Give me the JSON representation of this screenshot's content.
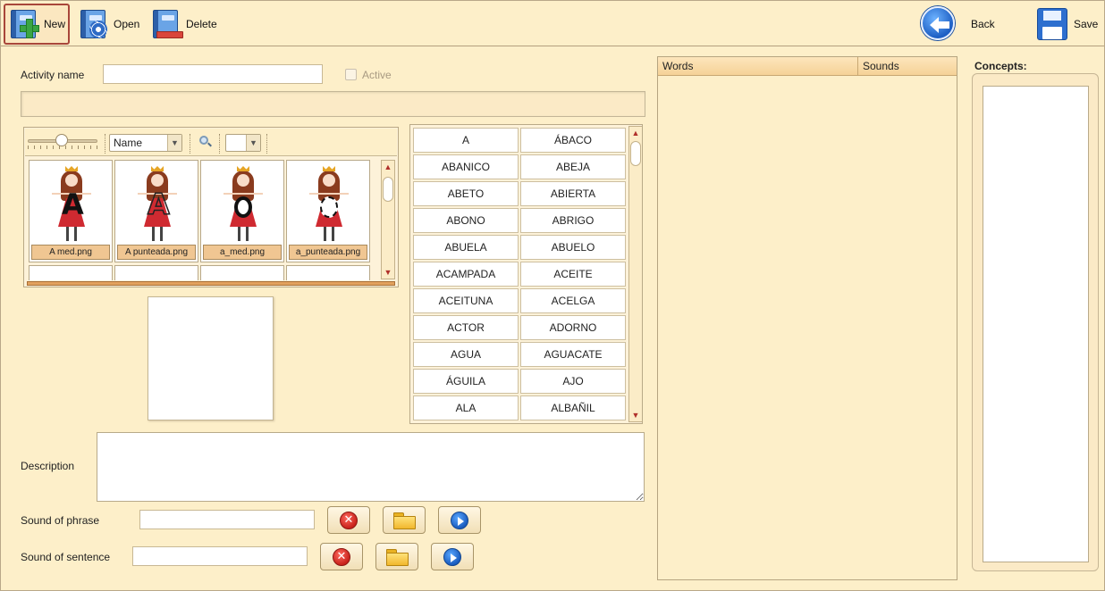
{
  "toolbar": {
    "new_label": "New",
    "open_label": "Open",
    "delete_label": "Delete",
    "back_label": "Back",
    "save_label": "Save"
  },
  "form": {
    "activity_name_label": "Activity name",
    "activity_name_value": "",
    "active_label": "Active",
    "description_label": "Description",
    "sound_phrase_label": "Sound of phrase",
    "sound_phrase_value": "",
    "sound_sentence_label": "Sound of sentence",
    "sound_sentence_value": ""
  },
  "browser": {
    "sort_value": "Name",
    "images": [
      {
        "caption": "A med.png",
        "letter": "A",
        "style": "solid"
      },
      {
        "caption": "A punteada.png",
        "letter": "A",
        "style": "dotted"
      },
      {
        "caption": "a_med.png",
        "letter": "o",
        "style": "solid"
      },
      {
        "caption": "a_punteada.png",
        "letter": "o",
        "style": "dotted"
      }
    ]
  },
  "words": [
    [
      "A",
      "ÁBACO"
    ],
    [
      "ABANICO",
      "ABEJA"
    ],
    [
      "ABETO",
      "ABIERTA"
    ],
    [
      "ABONO",
      "ABRIGO"
    ],
    [
      "ABUELA",
      "ABUELO"
    ],
    [
      "ACAMPADA",
      "ACEITE"
    ],
    [
      "ACEITUNA",
      "ACELGA"
    ],
    [
      "ACTOR",
      "ADORNO"
    ],
    [
      "AGUA",
      "AGUACATE"
    ],
    [
      "ÁGUILA",
      "AJO"
    ],
    [
      "ALA",
      "ALBAÑIL"
    ]
  ],
  "words_table": {
    "col_words": "Words",
    "col_sounds": "Sounds"
  },
  "concepts": {
    "title": "Concepts:"
  },
  "icons": {
    "new": "new-book-plus-icon",
    "open": "open-book-gear-icon",
    "delete": "delete-book-minus-icon",
    "back": "back-arrow-icon",
    "save": "floppy-save-icon",
    "clear": "red-x-icon",
    "browse": "folder-icon",
    "play": "play-icon"
  }
}
